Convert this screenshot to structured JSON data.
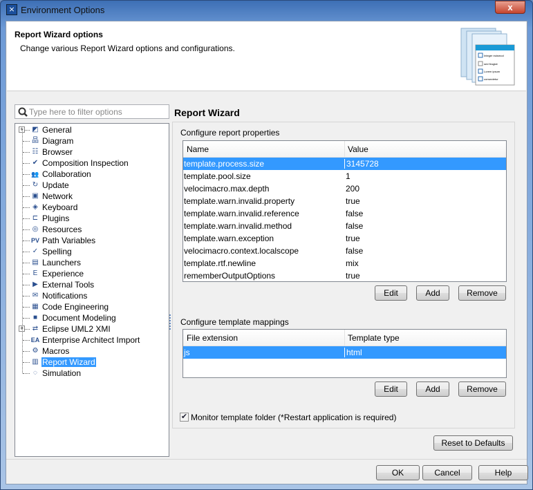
{
  "window": {
    "title": "Environment Options",
    "close_label": "x"
  },
  "header": {
    "title": "Report Wizard options",
    "description": "Change various Report Wizard options and configurations.",
    "image_items": [
      "Integer euismod mollis",
      "sed feugiat diam et.",
      "Lorem ipsum dolor",
      "consectetur elit."
    ]
  },
  "filter": {
    "placeholder": "Type here to filter options",
    "value": ""
  },
  "tree": [
    {
      "label": "General",
      "icon": "general-icon",
      "glyph": "◩",
      "expandable": true
    },
    {
      "label": "Diagram",
      "icon": "diagram-icon",
      "glyph": "品"
    },
    {
      "label": "Browser",
      "icon": "browser-icon",
      "glyph": "☷"
    },
    {
      "label": "Composition Inspection",
      "icon": "composition-inspection-icon",
      "glyph": "✔"
    },
    {
      "label": "Collaboration",
      "icon": "collaboration-icon",
      "glyph": "👥"
    },
    {
      "label": "Update",
      "icon": "update-icon",
      "glyph": "↻"
    },
    {
      "label": "Network",
      "icon": "network-icon",
      "glyph": "▣"
    },
    {
      "label": "Keyboard",
      "icon": "keyboard-icon",
      "glyph": "◈"
    },
    {
      "label": "Plugins",
      "icon": "plugin-icon",
      "glyph": "⊏"
    },
    {
      "label": "Resources",
      "icon": "resources-icon",
      "glyph": "◎"
    },
    {
      "label": "Path Variables",
      "icon": "path-variables-icon",
      "glyph": "PV"
    },
    {
      "label": "Spelling",
      "icon": "spelling-icon",
      "glyph": "✓"
    },
    {
      "label": "Launchers",
      "icon": "launchers-icon",
      "glyph": "▤"
    },
    {
      "label": "Experience",
      "icon": "experience-icon",
      "glyph": "E"
    },
    {
      "label": "External Tools",
      "icon": "external-tools-icon",
      "glyph": "▶"
    },
    {
      "label": "Notifications",
      "icon": "envelope-icon",
      "glyph": "✉"
    },
    {
      "label": "Code Engineering",
      "icon": "code-engineering-icon",
      "glyph": "▦"
    },
    {
      "label": "Document Modeling",
      "icon": "document-modeling-icon",
      "glyph": "■"
    },
    {
      "label": "Eclipse UML2 XMI",
      "icon": "eclipse-uml2-icon",
      "glyph": "⇄",
      "expandable": true
    },
    {
      "label": "Enterprise Architect Import",
      "icon": "ea-import-icon",
      "glyph": "EA"
    },
    {
      "label": "Macros",
      "icon": "macros-icon",
      "glyph": "⚙"
    },
    {
      "label": "Report Wizard",
      "icon": "report-wizard-icon",
      "glyph": "▥",
      "selected": true
    },
    {
      "label": "Simulation",
      "icon": "simulation-icon",
      "glyph": "◌"
    }
  ],
  "panel": {
    "title": "Report Wizard",
    "properties": {
      "label": "Configure report properties",
      "columns": [
        "Name",
        "Value"
      ],
      "rows": [
        [
          "template.process.size",
          "3145728"
        ],
        [
          "template.pool.size",
          "1"
        ],
        [
          "velocimacro.max.depth",
          "200"
        ],
        [
          "template.warn.invalid.property",
          "true"
        ],
        [
          "template.warn.invalid.reference",
          "false"
        ],
        [
          "template.warn.invalid.method",
          "false"
        ],
        [
          "template.warn.exception",
          "true"
        ],
        [
          "velocimacro.context.localscope",
          "false"
        ],
        [
          "template.rtf.newline",
          "mix"
        ],
        [
          "rememberOutputOptions",
          "true"
        ]
      ],
      "selected_row": 0
    },
    "mappings": {
      "label": "Configure template mappings",
      "columns": [
        "File extension",
        "Template type"
      ],
      "rows": [
        [
          "js",
          "html"
        ]
      ],
      "selected_row": 0
    },
    "buttons": {
      "edit": "Edit",
      "add": "Add",
      "remove": "Remove"
    },
    "monitor": {
      "label": "Monitor template folder (*Restart application is required)",
      "checked": true
    },
    "reset": "Reset to Defaults"
  },
  "footer": {
    "ok": "OK",
    "cancel": "Cancel",
    "help": "Help"
  },
  "colors": {
    "selection": "#3399ff",
    "title_bar": "#3d6fb5"
  }
}
